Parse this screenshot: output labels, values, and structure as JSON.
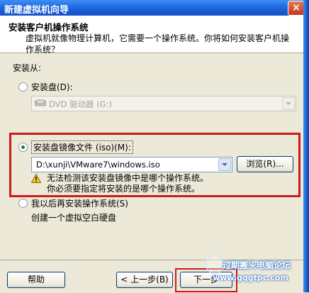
{
  "window": {
    "title": "新建虚拟机向导",
    "close_glyph": "×"
  },
  "header": {
    "title": "安装客户机操作系统",
    "description": "虚拟机就像物理计算机，它需要一个操作系统。你将如何安装客户机操作系统？"
  },
  "install_from": {
    "label": "安装从:",
    "option_disc": {
      "label": "安装盘(D):",
      "selected": false,
      "dropdown_value": "DVD 驱动器 (G:)",
      "icon": "dvd-drive-icon"
    },
    "option_iso": {
      "label": "安装盘镜像文件 (iso)(M):",
      "selected": true,
      "path_value": "D:\\xunji\\VMware7\\windows.iso",
      "browse_label": "浏览(R)...",
      "warning_line1": "无法检测该安装盘镜像中是哪个操作系统。",
      "warning_line2": "你必须要指定将安装的是哪个操作系统。",
      "warning_icon": "warning-icon"
    },
    "option_later": {
      "label": "我以后再安装操作系统(S)",
      "selected": false,
      "description": "创建一个虚拟空白硬盘"
    }
  },
  "footer": {
    "help_label": "帮助",
    "back_label": "< 上一步(B)",
    "next_label": "下一步"
  },
  "watermark": {
    "line1": "过期搬头电脑论坛",
    "line2": "www.gqgtpc.com"
  },
  "colors": {
    "highlight_box": "#d0191c",
    "title_bar": "#1a5fd8"
  }
}
